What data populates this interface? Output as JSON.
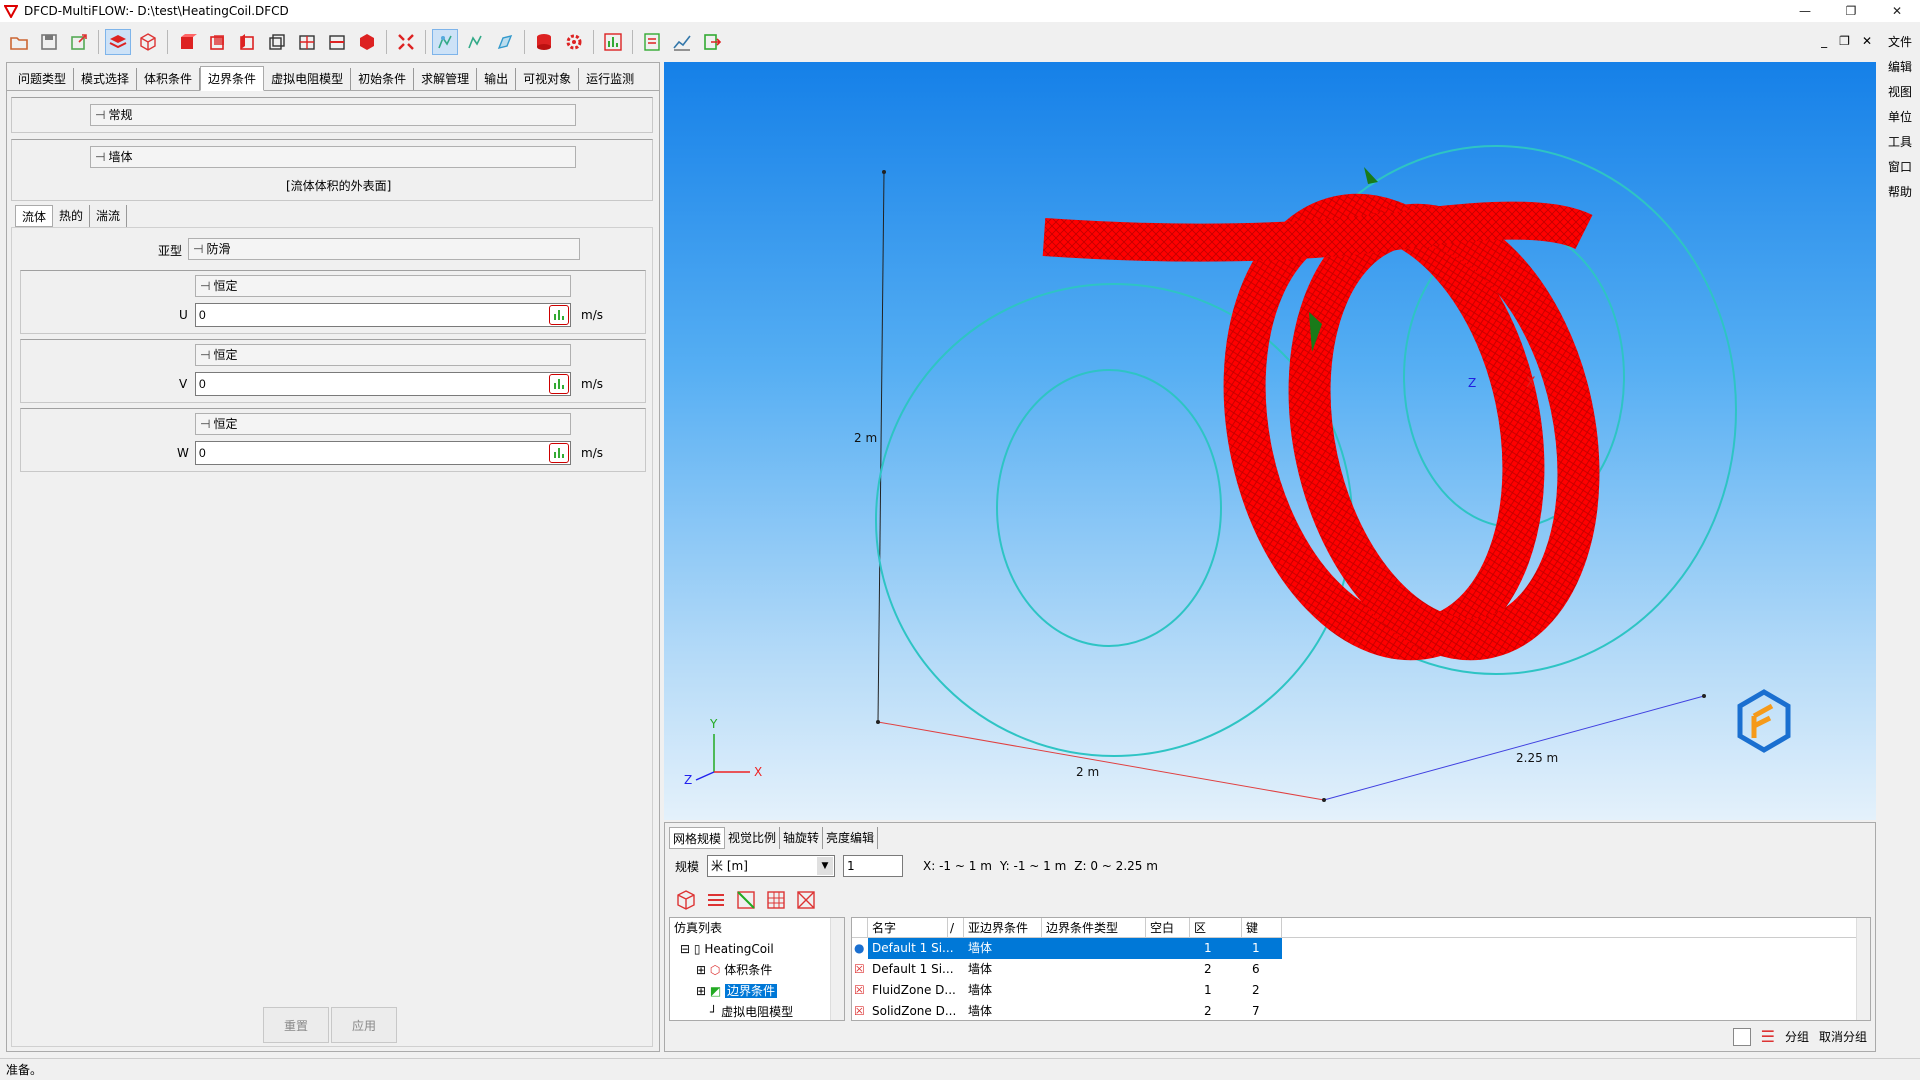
{
  "window": {
    "title": "DFCD-MultiFLOW:- D:\\test\\HeatingCoil.DFCD",
    "minimize": "—",
    "restore": "❐",
    "close": "✕",
    "mdi_minimize": "_",
    "mdi_restore": "❐",
    "mdi_close": "✕"
  },
  "right_menu": [
    "文件",
    "编辑",
    "视图",
    "单位",
    "工具",
    "窗口",
    "帮助"
  ],
  "main_tabs": [
    "问题类型",
    "模式选择",
    "体积条件",
    "边界条件",
    "虚拟电阻模型",
    "初始条件",
    "求解管理",
    "输出",
    "可视对象",
    "运行监测"
  ],
  "active_main_tab": "边界条件",
  "panel": {
    "general_combo": "常规",
    "wall_combo": "墙体",
    "wall_note": "[流体体积的外表面]",
    "sub_tabs": [
      "流体",
      "热的",
      "湍流"
    ],
    "subtype_label": "亚型",
    "subtype_value": "防滑",
    "u": {
      "mode": "恒定",
      "label": "U",
      "value": "0",
      "unit": "m/s"
    },
    "v": {
      "mode": "恒定",
      "label": "V",
      "value": "0",
      "unit": "m/s"
    },
    "w": {
      "mode": "恒定",
      "label": "W",
      "value": "0",
      "unit": "m/s"
    },
    "reset_button": "重置",
    "apply_button": "应用"
  },
  "viewport": {
    "dim_vertical": "2 m",
    "dim_x": "2 m",
    "dim_z": "2.25 m",
    "axis_y": "Y",
    "axis_x": "X",
    "axis_z": "Z",
    "label_x_red": "X",
    "label_z_blue": "Z"
  },
  "bottom": {
    "tabs": [
      "网格规模",
      "视觉比例",
      "轴旋转",
      "亮度编辑"
    ],
    "scale_label": "规模",
    "scale_unit": "米 [m]",
    "scale_value": "1",
    "range_x": "X: -1 ~ 1 m",
    "range_y": "Y: -1 ~ 1 m",
    "range_z": "Z: 0 ~ 2.25 m",
    "tree_header": "仿真列表",
    "tree": [
      "HeatingCoil",
      "体积条件",
      "边界条件",
      "虚拟电阻模型"
    ],
    "columns": [
      "名字",
      "亚边界条件",
      "边界条件类型",
      "空白",
      "区",
      "键"
    ],
    "sort_mark": "/",
    "rows": [
      {
        "name": "Default 1 Si...",
        "sub": "墙体",
        "type": "",
        "blank": "",
        "zone": "1",
        "key": "1"
      },
      {
        "name": "Default 1 Si...",
        "sub": "墙体",
        "type": "",
        "blank": "",
        "zone": "2",
        "key": "6"
      },
      {
        "name": "FluidZone D...",
        "sub": "墙体",
        "type": "",
        "blank": "",
        "zone": "1",
        "key": "2"
      },
      {
        "name": "SolidZone D...",
        "sub": "墙体",
        "type": "",
        "blank": "",
        "zone": "2",
        "key": "7"
      }
    ],
    "group_label": "分组",
    "ungroup_label": "取消分组"
  },
  "status": "准备。",
  "colors": {
    "accent": "#0078d7",
    "mesh": "#ff0000",
    "outline": "#2ec4c4"
  },
  "icons": [
    "open-icon",
    "save-icon",
    "export-icon",
    "layers-icon",
    "cube-outline-icon",
    "red-cube-icon",
    "fit-view-icon",
    "chart-icon",
    "exit-icon"
  ]
}
